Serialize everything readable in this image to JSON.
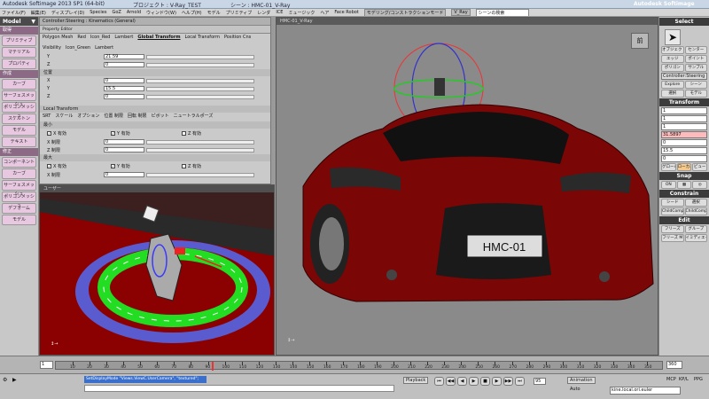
{
  "titlebar": {
    "app": "Autodesk Softimage 2013 SP1 (64-bit)",
    "project": "プロジェクト : V-Ray_TEST",
    "scene": "シーン : HMC-01_V-Ray",
    "brand": "Autodesk Softimage"
  },
  "menubar": {
    "items": [
      "ファイル(F)",
      "編集(E)",
      "ディスプレイ(D)",
      "Species",
      "GoZ",
      "Arnold",
      "ウィンドウ(W)",
      "ヘルプ(H)",
      "モデル",
      "プリミティブ",
      "レンダ",
      "ICE",
      "ミュージック",
      "ヘア",
      "Face Robot"
    ],
    "layout": "モデリング/コンストラクションモード",
    "render": "V_Ray",
    "search": "シーンの検索"
  },
  "leftpanel": {
    "title": "Model",
    "items": [
      {
        "label": "取得",
        "type": "head"
      },
      {
        "label": "プリミティブ",
        "type": "pink"
      },
      {
        "label": "マテリアル",
        "type": "pink"
      },
      {
        "label": "プロパティ",
        "type": "pink"
      },
      {
        "label": "作成",
        "type": "head"
      },
      {
        "label": "カーブ",
        "type": "pink"
      },
      {
        "label": "サーフェスメッシュ",
        "type": "pink"
      },
      {
        "label": "ポリゴンメッシュ",
        "type": "pink"
      },
      {
        "label": "スケルトン",
        "type": "pink"
      },
      {
        "label": "モデル",
        "type": "pink"
      },
      {
        "label": "テキスト",
        "type": "pink"
      },
      {
        "label": "修正",
        "type": "head"
      },
      {
        "label": "コンポーネント",
        "type": "pink"
      },
      {
        "label": "カーブ",
        "type": "pink"
      },
      {
        "label": "サーフェスメッシュ",
        "type": "pink"
      },
      {
        "label": "ポリゴンメッシュ",
        "type": "pink"
      },
      {
        "label": "デフォーム",
        "type": "pink"
      },
      {
        "label": "モデル",
        "type": "pink"
      }
    ]
  },
  "propeditor": {
    "window_title": "Property Editor",
    "header": "Controller:Steering : Kinematics (General)",
    "tabs": [
      "Polygon Mesh",
      "Red",
      "Icon_Red",
      "Lambert",
      "Global Transform",
      "Local Transform",
      "Position Cns",
      "Visibility",
      "Icon_Green",
      "Lambert"
    ],
    "active_tab": "Global Transform",
    "rows_top": [
      {
        "label": "Y",
        "value": "21.59"
      },
      {
        "label": "Z",
        "value": "0"
      }
    ],
    "position_label": "位置",
    "position_rows": [
      {
        "label": "X",
        "value": "0"
      },
      {
        "label": "Y",
        "value": "15.5"
      },
      {
        "label": "Z",
        "value": "0"
      }
    ],
    "local_section": "Local Transform",
    "subtabs": [
      "SRT",
      "スケール",
      "オプション",
      "位置 制限",
      "回転 制限",
      "ピボット",
      "ニュートラルポーズ"
    ],
    "min_label": "最小",
    "max_label": "最大",
    "x_enable": "X 有効",
    "y_enable": "Y 有効",
    "z_enable": "Z 有効",
    "x_min": "X 制限",
    "y_min": "Y 制限",
    "z_min": "Z 制限",
    "zero": "0"
  },
  "persp": {
    "header": "ユーザー"
  },
  "mainview": {
    "header": "HMC-01_V-Ray",
    "cube_label": "前",
    "plate": "HMC-01"
  },
  "rightpanel": {
    "select_title": "Select",
    "select_rows": [
      [
        "オブジェクト",
        "センター"
      ],
      [
        "エッジ",
        "ポイント"
      ],
      [
        "ポリゴン",
        "サンプル"
      ]
    ],
    "selected": "Controller:Steering",
    "explore": "Explore",
    "scene": "シーン",
    "select_btns": [
      "選択",
      "モデル"
    ],
    "transform_title": "Transform",
    "sx": "1",
    "ry": "31.5897",
    "px": "0",
    "py": "15.5",
    "pz": "0",
    "space": [
      "グローバル",
      "ローカル",
      "ビュー"
    ],
    "snap_title": "Snap",
    "snap_on": "ON",
    "constrain_title": "Constrain",
    "constrain_btns": [
      "シード",
      "選択"
    ],
    "comp_btns": [
      "ChildComp",
      "ChildComp"
    ],
    "edit_title": "Edit",
    "edit_btns": [
      "フリーズ",
      "グループ",
      "フリーズ M",
      "イミディエイト"
    ]
  },
  "timeline": {
    "start": "1",
    "end": "360",
    "ticks": [
      "10",
      "20",
      "30",
      "40",
      "50",
      "60",
      "70",
      "80",
      "90",
      "100",
      "110",
      "120",
      "130",
      "140",
      "150",
      "160",
      "170",
      "180",
      "190",
      "200",
      "210",
      "220",
      "230",
      "240",
      "250",
      "260",
      "270",
      "280",
      "290",
      "300",
      "310",
      "320",
      "330",
      "340",
      "350"
    ]
  },
  "cmdbar": {
    "command": "SetDisplayMode \"Views.ViewC.UserCamera\", \"textured\";",
    "playback": "Playback",
    "frame": "95",
    "animation": "Animation",
    "auto": "Auto",
    "mcp": "MCP",
    "kp": "KP/L",
    "ppg": "PPG",
    "status": "kine.local.ori.euler"
  },
  "colors": {
    "accent": "#3a6fcc",
    "car_red": "#8b0000",
    "ring_green": "#22dd22",
    "ring_blue": "#5b5bd0"
  }
}
